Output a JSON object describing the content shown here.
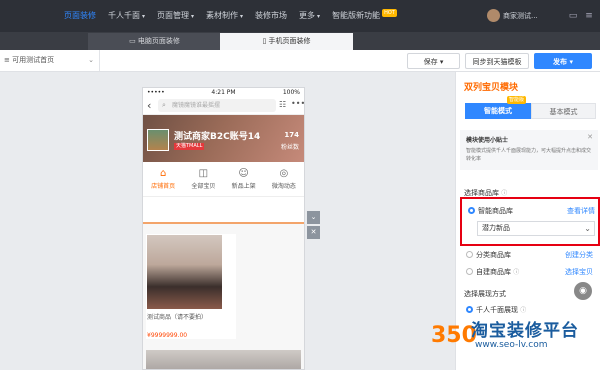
{
  "topnav": {
    "items": [
      {
        "label": "页面装修",
        "caret": false,
        "active": true
      },
      {
        "label": "千人千面",
        "caret": true,
        "active": false
      },
      {
        "label": "页面管理",
        "caret": true,
        "active": false
      },
      {
        "label": "素材制作",
        "caret": true,
        "active": false
      },
      {
        "label": "装修市场",
        "caret": false,
        "active": false
      },
      {
        "label": "更多",
        "caret": true,
        "active": false
      }
    ],
    "smart_label": "智能版新功能",
    "smart_badge": "HOT",
    "user_name": "商家测试..."
  },
  "tabs": {
    "pc_label": "电脑页面装修",
    "mobile_label": "手机页面装修"
  },
  "toolbar": {
    "page_select_value": "可用测试首页",
    "save_label": "保存",
    "sync_label": "同步到天猫模板",
    "publish_label": "发布"
  },
  "phone": {
    "status_time": "4:21 PM",
    "status_battery": "100%",
    "search_placeholder": "魔镜魔镜谁最摇摆",
    "shop_name": "测试商家B2C账号14",
    "shop_tag": "天猫TMALL",
    "fans_count": "174",
    "fans_label": "粉丝数",
    "nav": [
      {
        "icon": "store-icon",
        "label": "店铺首页",
        "glyph": "⌂",
        "active": true
      },
      {
        "icon": "bag-icon",
        "label": "全部宝贝",
        "glyph": "◫",
        "active": false
      },
      {
        "icon": "new-icon",
        "label": "新品上架",
        "glyph": "☺",
        "active": false
      },
      {
        "icon": "broadcast-icon",
        "label": "微淘动态",
        "glyph": "◎",
        "active": false
      }
    ],
    "product": {
      "title": "测试商品（请不要拍）",
      "price": "¥9999999.00"
    }
  },
  "panel": {
    "title": "双列宝贝模块",
    "mode_smart": "智能模式",
    "mode_smart_badge": "智能版",
    "mode_basic": "基本模式",
    "tip_title": "模块使用小贴士",
    "tip_text": "智能模式提供千人千面展现能力，可大幅提升点击和成交转化率",
    "select_library_label": "选择商品库",
    "smart_library_label": "智能商品库",
    "smart_library_link": "查看详情",
    "smart_library_value": "潜力新品",
    "category_library_label": "分类商品库",
    "category_library_link": "创建分类",
    "custom_library_label": "自建商品库",
    "custom_library_link": "选择宝贝",
    "display_label": "选择展现方式",
    "display_option": "千人千面展现"
  },
  "watermark": {
    "logo_text": "350",
    "title": "淘宝装修平台",
    "url": "www.seo-lv.com"
  },
  "colors": {
    "accent": "#2f87ff",
    "orange": "#ff6a00",
    "highlight": "#e60012"
  }
}
